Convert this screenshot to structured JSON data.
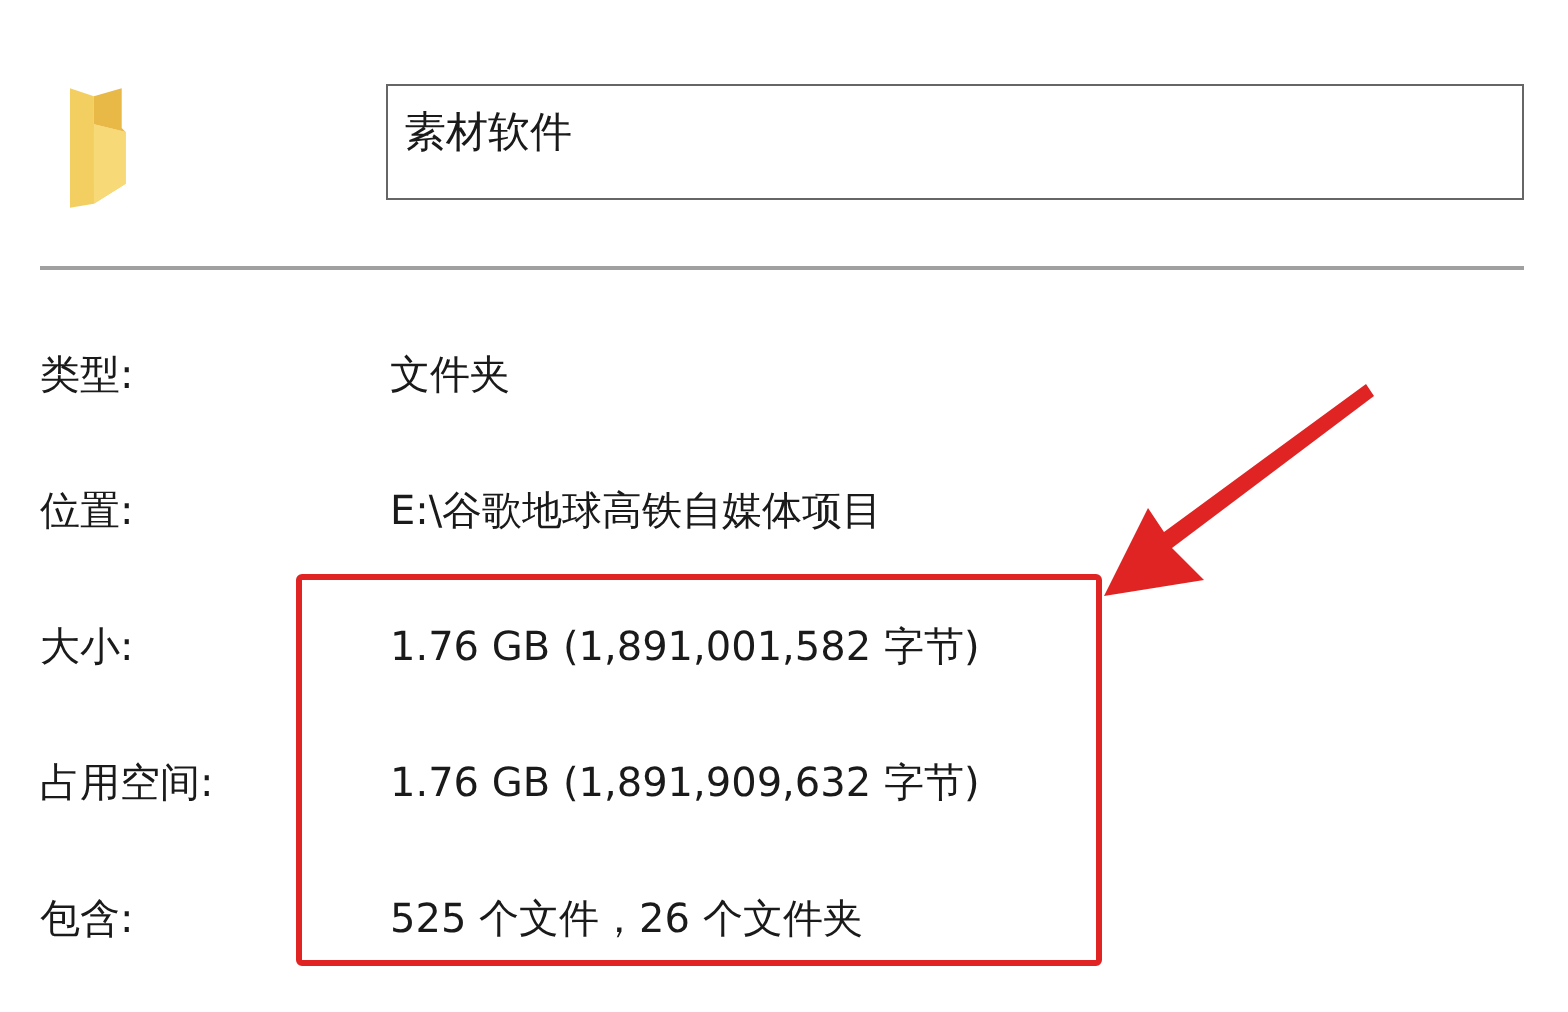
{
  "folder_name": "素材软件",
  "properties": [
    {
      "label": "类型:",
      "value": "文件夹"
    },
    {
      "label": "位置:",
      "value": "E:\\谷歌地球高铁自媒体项目"
    },
    {
      "label": "大小:",
      "value": "1.76 GB (1,891,001,582 字节)"
    },
    {
      "label": "占用空间:",
      "value": "1.76 GB (1,891,909,632 字节)"
    },
    {
      "label": "包含:",
      "value": "525 个文件，26 个文件夹"
    }
  ]
}
